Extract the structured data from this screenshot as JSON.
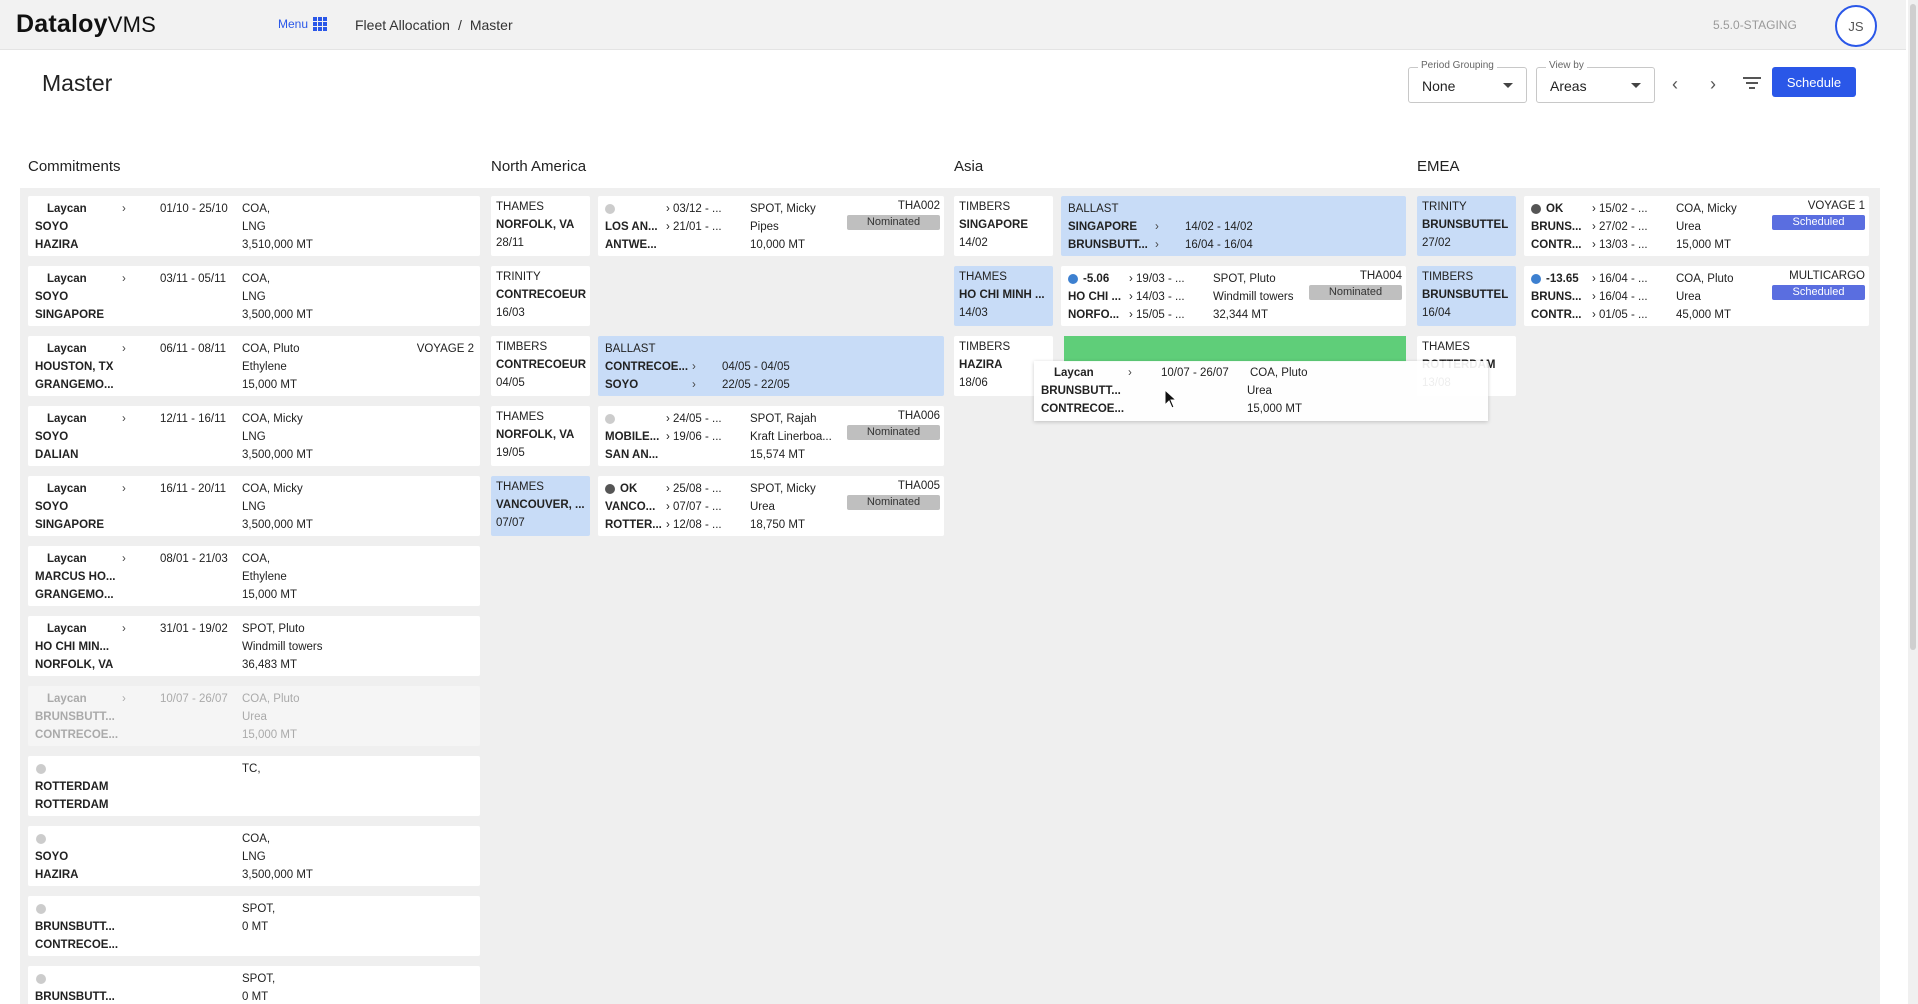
{
  "app": {
    "brand_bold": "Dataloy",
    "brand_light": "VMS",
    "menu_label": "Menu",
    "version": "5.5.0-STAGING",
    "user_initials": "JS"
  },
  "breadcrumb": [
    "Fleet Allocation",
    "/",
    "Master"
  ],
  "page": {
    "title": "Master"
  },
  "controls": {
    "period_grouping": {
      "label": "Period Grouping",
      "value": "None"
    },
    "view_by": {
      "label": "View by",
      "value": "Areas"
    },
    "prev_glyph": "‹",
    "next_glyph": "›",
    "schedule_label": "Schedule"
  },
  "columns": [
    "Commitments",
    "North America",
    "Asia",
    "EMEA"
  ],
  "commitments": [
    {
      "a": "Laycan",
      "b": "SOYO",
      "c": "HAZIRA",
      "dates": "01/10 - 25/10",
      "d1": "COA,",
      "d2": "LNG",
      "d3": "3,510,000 MT"
    },
    {
      "a": "Laycan",
      "b": "SOYO",
      "c": "SINGAPORE",
      "dates": "03/11 - 05/11",
      "d1": "COA,",
      "d2": "LNG",
      "d3": "3,500,000 MT"
    },
    {
      "a": "Laycan",
      "b": "HOUSTON, TX",
      "c": "GRANGEMO...",
      "dates": "06/11 - 08/11",
      "d1": "COA, Pluto",
      "d2": "Ethylene",
      "d3": "15,000 MT",
      "tag": "VOYAGE 2"
    },
    {
      "a": "Laycan",
      "b": "SOYO",
      "c": "DALIAN",
      "dates": "12/11 - 16/11",
      "d1": "COA, Micky",
      "d2": "LNG",
      "d3": "3,500,000 MT"
    },
    {
      "a": "Laycan",
      "b": "SOYO",
      "c": "SINGAPORE",
      "dates": "16/11 - 20/11",
      "d1": "COA, Micky",
      "d2": "LNG",
      "d3": "3,500,000 MT"
    },
    {
      "a": "Laycan",
      "b": "MARCUS HO...",
      "c": "GRANGEMO...",
      "dates": "08/01 - 21/03",
      "d1": "COA,",
      "d2": "Ethylene",
      "d3": "15,000 MT"
    },
    {
      "a": "Laycan",
      "b": "HO CHI MIN...",
      "c": "NORFOLK, VA",
      "dates": "31/01 - 19/02",
      "d1": "SPOT, Pluto",
      "d2": "Windmill towers",
      "d3": "36,483 MT"
    },
    {
      "a": "Laycan",
      "b": "BRUNSBUTT...",
      "c": "CONTRECOE...",
      "dates": "10/07 - 26/07",
      "d1": "COA, Pluto",
      "d2": "Urea",
      "d3": "15,000 MT",
      "faded": true
    },
    {
      "a": "",
      "b": "ROTTERDAM",
      "c": "ROTTERDAM",
      "dates": "",
      "d1": "TC,",
      "d2": "",
      "d3": "",
      "dot": true
    },
    {
      "a": "",
      "b": "SOYO",
      "c": "HAZIRA",
      "dates": "",
      "d1": "COA,",
      "d2": "LNG",
      "d3": "3,500,000 MT",
      "dot": true
    },
    {
      "a": "",
      "b": "BRUNSBUTT...",
      "c": "CONTRECOE...",
      "dates": "",
      "d1": "SPOT,",
      "d2": "0 MT",
      "d3": "",
      "dot": true
    },
    {
      "a": "",
      "b": "BRUNSBUTT...",
      "c": "",
      "dates": "",
      "d1": "SPOT,",
      "d2": "0 MT",
      "d3": "",
      "dot": true
    }
  ],
  "north_america": {
    "vessels": [
      {
        "name": "THAMES",
        "port": "NORFOLK, VA",
        "date": "28/11"
      },
      {
        "name": "TRINITY",
        "port": "CONTRECOEUR",
        "date": "16/03"
      },
      {
        "name": "TIMBERS",
        "port": "CONTRECOEUR",
        "date": "04/05"
      },
      {
        "name": "THAMES",
        "port": "NORFOLK, VA",
        "date": "19/05"
      },
      {
        "name": "THAMES",
        "port": "VANCOUVER, ...",
        "date": "07/07"
      }
    ],
    "voyages": [
      {
        "status": "",
        "p1": "LOS AN...",
        "p2": "ANTWE...",
        "t1": "› 03/12 - ...",
        "t2": "› 21/01 - ...",
        "d1": "SPOT, Micky",
        "d2": "Pipes",
        "d3": "10,000 MT",
        "code": "THA002",
        "badge": "Nominated"
      },
      {
        "status": "",
        "p1": "MOBILE...",
        "p2": "SAN AN...",
        "t1": "› 24/05 - ...",
        "t2": "› 19/06 - ...",
        "d1": "SPOT, Rajah",
        "d2": "Kraft Linerboa...",
        "d3": "15,574 MT",
        "code": "THA006",
        "badge": "Nominated"
      },
      {
        "status": "OK",
        "p1": "VANCO...",
        "p2": "ROTTER...",
        "t1": "› 25/08 - ...",
        "t2": "› 07/07 - ...",
        "t3": "› 12/08 - ...",
        "d1": "SPOT, Micky",
        "d2": "Urea",
        "d3": "18,750 MT",
        "code": "THA005",
        "badge": "Nominated"
      }
    ],
    "ballast": {
      "label": "BALLAST",
      "p1": "CONTRECOE...",
      "p2": "SOYO",
      "r1": "04/05 - 04/05",
      "r2": "22/05 - 22/05",
      "chev": "›"
    }
  },
  "asia": {
    "vessels": [
      {
        "name": "TIMBERS",
        "port": "SINGAPORE",
        "date": "14/02"
      },
      {
        "name": "THAMES",
        "port": "HO CHI MINH ...",
        "date": "14/03"
      },
      {
        "name": "TIMBERS",
        "port": "HAZIRA",
        "date": "18/06"
      }
    ],
    "ballast": {
      "label": "BALLAST",
      "p1": "SINGAPORE",
      "p2": "BRUNSBUTT...",
      "r1": "14/02 - 14/02",
      "r2": "16/04 - 16/04",
      "chev": "›"
    },
    "voyage": {
      "status": "-5.06",
      "p1": "HO CHI ...",
      "p2": "NORFO...",
      "t1": "› 19/03 - ...",
      "t2": "› 14/03 - ...",
      "t3": "› 15/05 - ...",
      "d1": "SPOT, Pluto",
      "d2": "Windmill towers",
      "d3": "32,344 MT",
      "code": "THA004",
      "badge": "Nominated"
    }
  },
  "emea": {
    "vessels": [
      {
        "name": "TRINITY",
        "port": "BRUNSBUTTEL",
        "date": "27/02"
      },
      {
        "name": "TIMBERS",
        "port": "BRUNSBUTTEL",
        "date": "16/04"
      },
      {
        "name": "THAMES",
        "port": "ROTTERDAM",
        "date": "13/08"
      }
    ],
    "voyages": [
      {
        "status": "OK",
        "p1": "BRUNS...",
        "p2": "CONTR...",
        "t1": "› 15/02 - ...",
        "t2": "› 27/02 - ...",
        "t3": "› 13/03 - ...",
        "d1": "COA, Micky",
        "d2": "Urea",
        "d3": "15,000 MT",
        "code": "VOYAGE 1",
        "badge": "Scheduled"
      },
      {
        "status": "-13.65",
        "p1": "BRUNS...",
        "p2": "CONTR...",
        "t1": "› 16/04 - ...",
        "t2": "› 16/04 - ...",
        "t3": "› 01/05 - ...",
        "d1": "COA, Pluto",
        "d2": "Urea",
        "d3": "45,000 MT",
        "code": "MULTICARGO",
        "badge": "Scheduled"
      }
    ]
  },
  "dragging": {
    "a": "Laycan",
    "b": "BRUNSBUTT...",
    "c": "CONTRECOE...",
    "dates": "10/07 - 26/07",
    "d1": "COA, Pluto",
    "d2": "Urea",
    "d3": "15,000 MT",
    "chev": "›"
  },
  "colors": {
    "accent": "#2a57e8",
    "ballast": "#c8dcf7",
    "drop_target": "#5fce79",
    "scheduled": "#5a6ee0",
    "nominated": "#bfbfbf"
  }
}
